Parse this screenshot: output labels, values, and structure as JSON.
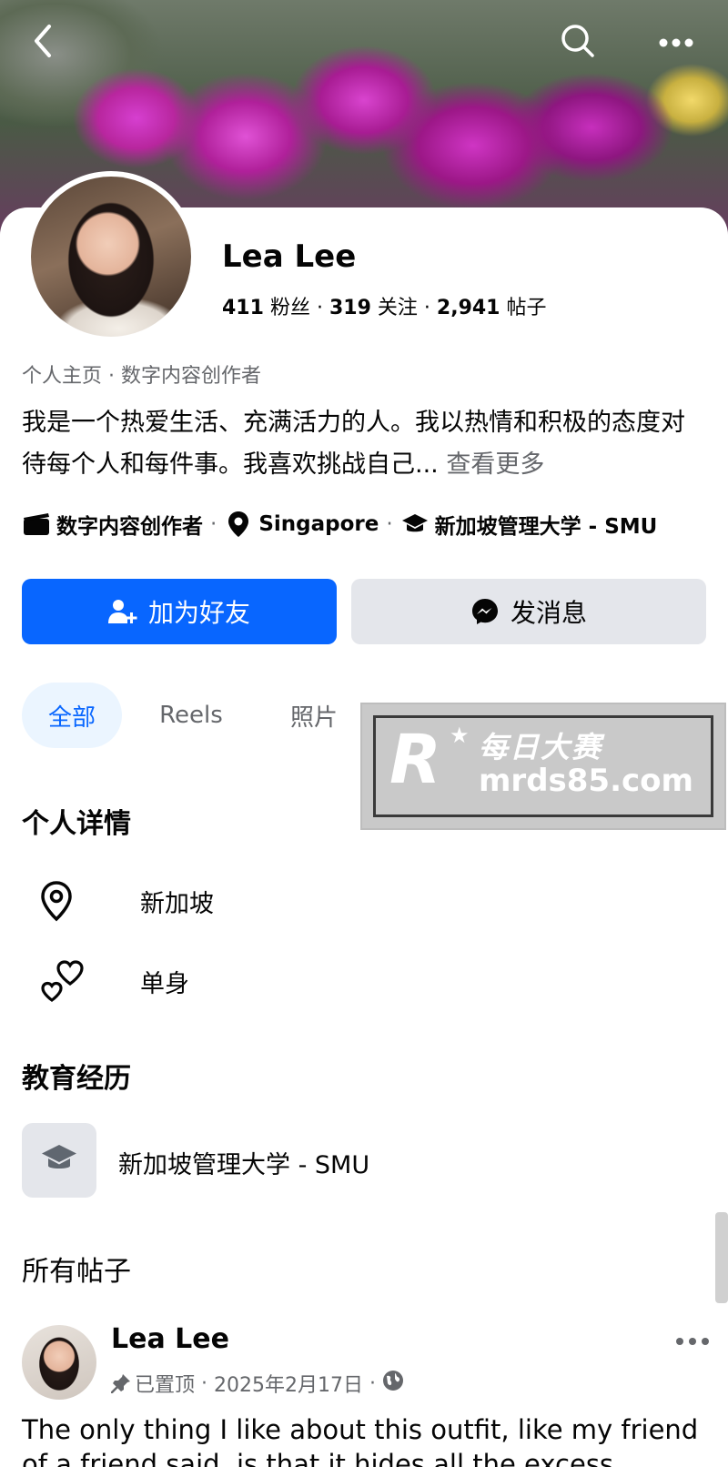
{
  "colors": {
    "primary": "#0866ff",
    "secondary_bg": "#e4e6eb",
    "muted_text": "#65676b",
    "tab_active_bg": "#ebf5ff"
  },
  "header": {
    "back_icon": "chevron-left-icon",
    "search_icon": "search-icon",
    "more_icon": "more-horizontal-icon"
  },
  "profile": {
    "name": "Lea Lee",
    "followers_count": "411",
    "followers_label": "粉丝",
    "following_count": "319",
    "following_label": "关注",
    "posts_count": "2,941",
    "posts_label": "帖子",
    "category": "个人主页 · 数字内容创作者",
    "bio": "我是一个热爱生活、充满活力的人。我以热情和积极的态度对待每个人和每件事。我喜欢挑战自己...",
    "see_more": "查看更多",
    "info": {
      "job": "数字内容创作者",
      "location": "Singapore",
      "school": "新加坡管理大学 - SMU"
    }
  },
  "actions": {
    "add_friend": "加为好友",
    "message": "发消息"
  },
  "tabs": [
    {
      "label": "全部"
    },
    {
      "label": "Reels"
    },
    {
      "label": "照片"
    }
  ],
  "watermark": {
    "brand_cn": "每日大赛",
    "url": "mrds85.com",
    "logo_letter": "R"
  },
  "details": {
    "title": "个人详情",
    "location": "新加坡",
    "relationship": "单身"
  },
  "education": {
    "title": "教育经历",
    "school": "新加坡管理大学 - SMU"
  },
  "posts": {
    "title": "所有帖子",
    "first": {
      "author": "Lea Lee",
      "pinned": "已置顶",
      "date": "2025年2月17日",
      "text": "The only thing I like about this outfit, like my friend of a friend said, is that it hides all the excess \"meat\""
    }
  }
}
